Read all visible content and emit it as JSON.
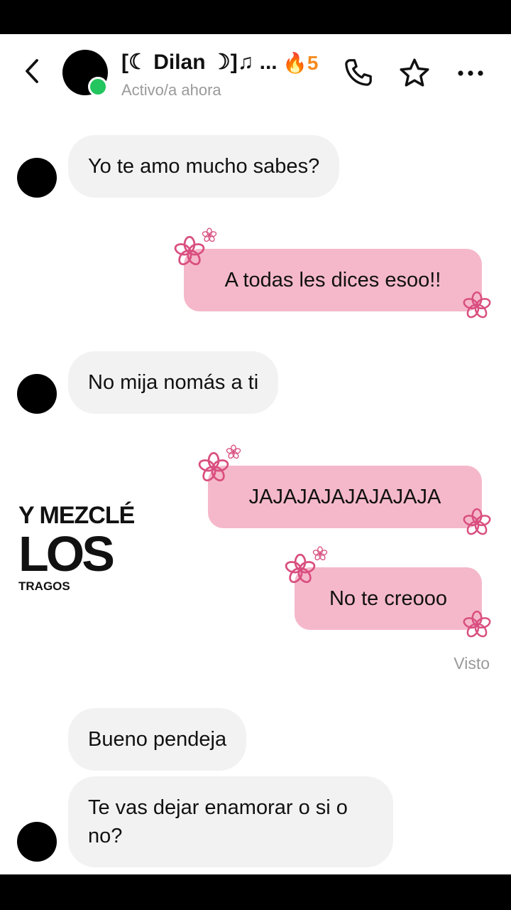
{
  "header": {
    "contact_name": "[☾ Dilan ☽]♫ ...",
    "streak": "🔥5",
    "status": "Activo/a ahora",
    "icons": [
      "back-arrow-icon",
      "phone-icon",
      "star-icon",
      "more-icon"
    ]
  },
  "messages": [
    {
      "side": "in",
      "text": "Yo te amo mucho sabes?"
    },
    {
      "side": "out",
      "text": "A todas les dices esoo!!"
    },
    {
      "side": "in",
      "text": "No mija nomás a ti"
    },
    {
      "side": "out",
      "text": "JAJAJAJAJAJAJAJA"
    },
    {
      "side": "out",
      "text": "No te creooo"
    },
    {
      "side": "in",
      "text": "Bueno pendeja"
    },
    {
      "side": "in",
      "text": "Te vas dejar enamorar o si o no?"
    }
  ],
  "seen_label": "Visto",
  "sticker": {
    "line1": "Y MEZCLÉ",
    "line2": "LOS",
    "line3": "TRAGOS"
  },
  "colors": {
    "out_bubble": "#f5b8cb",
    "in_bubble": "#f2f2f2",
    "flower": "#d94f7f",
    "online": "#22c55e",
    "streak": "#f58b1f"
  }
}
